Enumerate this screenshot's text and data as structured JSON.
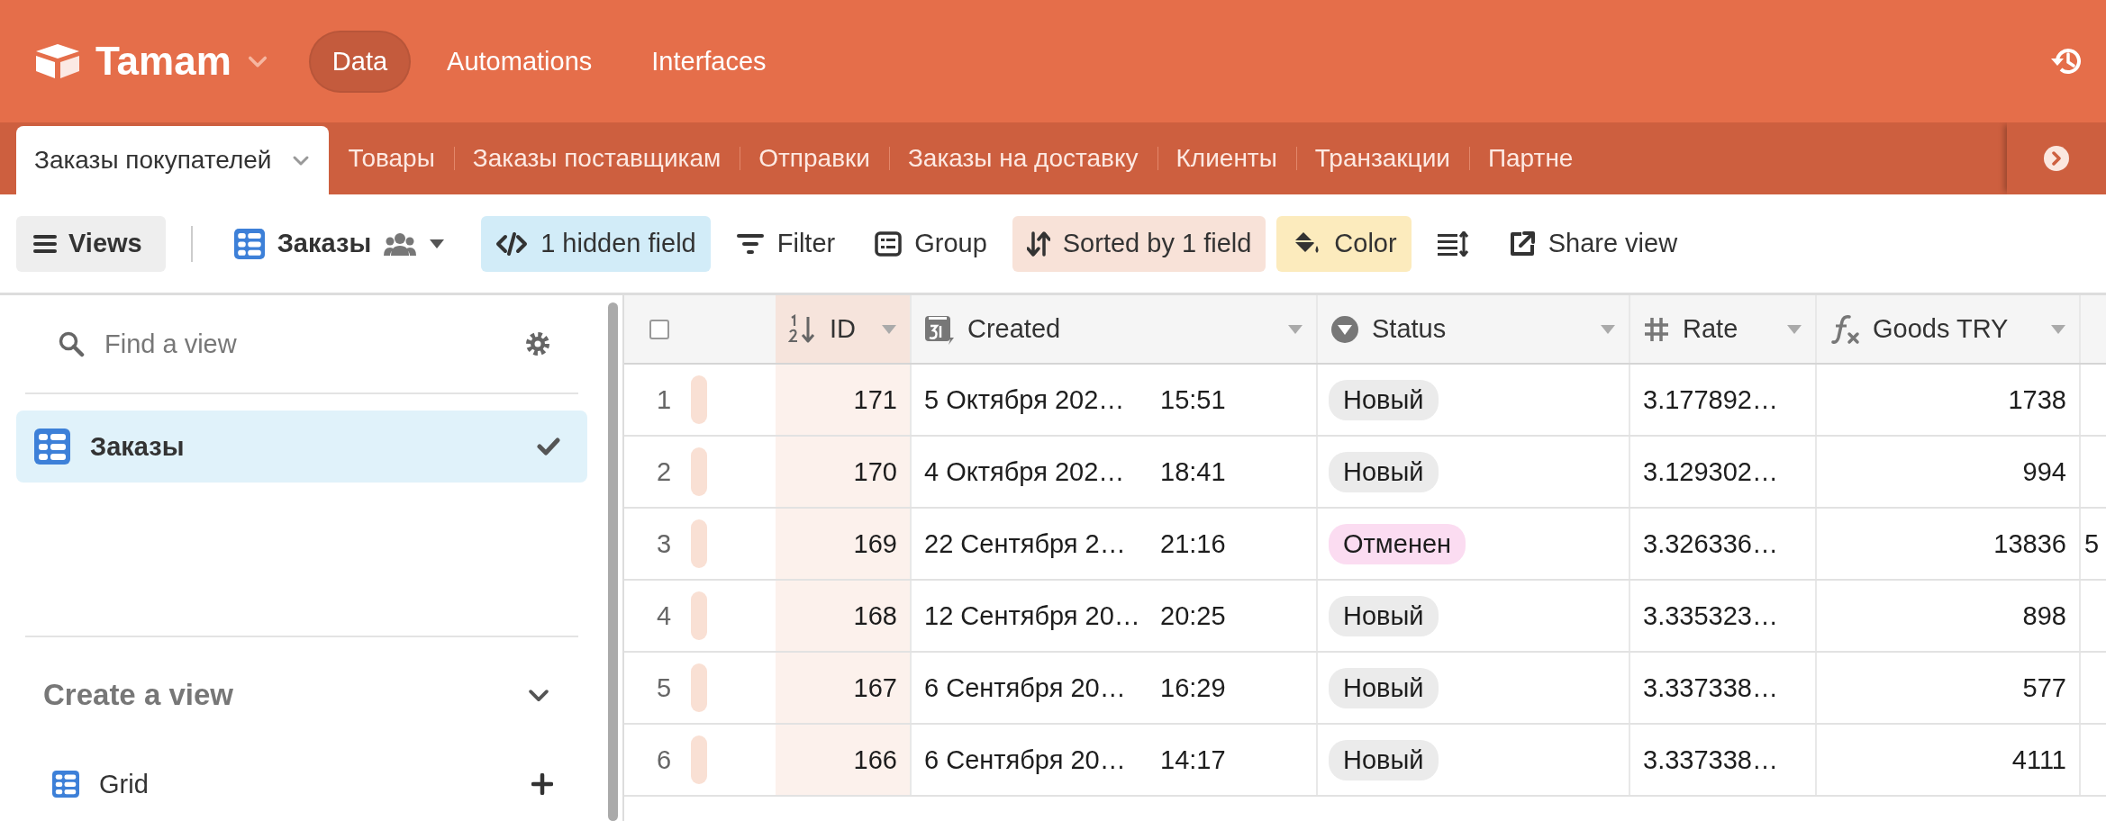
{
  "app": {
    "name": "Tamam",
    "nav": [
      {
        "label": "Data",
        "selected": true
      },
      {
        "label": "Automations",
        "selected": false
      },
      {
        "label": "Interfaces",
        "selected": false
      }
    ]
  },
  "tables": [
    {
      "label": "Заказы покупателей",
      "selected": true
    },
    {
      "label": "Товары",
      "selected": false
    },
    {
      "label": "Заказы поставщикам",
      "selected": false
    },
    {
      "label": "Отправки",
      "selected": false
    },
    {
      "label": "Заказы на доставку",
      "selected": false
    },
    {
      "label": "Клиенты",
      "selected": false
    },
    {
      "label": "Транзакции",
      "selected": false
    },
    {
      "label": "Партне",
      "selected": false
    }
  ],
  "toolbar": {
    "views_button": "Views",
    "view_name": "Заказы",
    "buttons": [
      {
        "kind": "hidden",
        "label": "1 hidden field",
        "active": true
      },
      {
        "kind": "filter",
        "label": "Filter",
        "active": false
      },
      {
        "kind": "group",
        "label": "Group",
        "active": false
      },
      {
        "kind": "sort",
        "label": "Sorted by 1 field",
        "active": true
      },
      {
        "kind": "color",
        "label": "Color",
        "active": true
      },
      {
        "kind": "rowheight",
        "active": false
      },
      {
        "kind": "share",
        "label": "Share view",
        "active": false
      }
    ]
  },
  "sidebar": {
    "search": {
      "placeholder": "Find a view"
    },
    "views": [
      {
        "label": "Заказы",
        "selected": true
      }
    ],
    "create": {
      "title": "Create a view",
      "expanded": true,
      "items": [
        {
          "label": "Grid"
        }
      ]
    }
  },
  "grid": {
    "select_all": {
      "checked": false
    },
    "columns": [
      {
        "kind": "number",
        "label": "ID",
        "sorted": true
      },
      {
        "kind": "date",
        "label": "Created",
        "sorted": false
      },
      {
        "kind": "select",
        "label": "Status",
        "sorted": false
      },
      {
        "kind": "decimal",
        "label": "Rate",
        "sorted": false
      },
      {
        "kind": "formula",
        "label": "Goods TRY",
        "sorted": false
      }
    ],
    "rows": [
      {
        "number": "1",
        "color": "#f9e0d4",
        "id": "171",
        "date": "5 Октября 202…",
        "time": "15:51",
        "status": {
          "label": "Новый",
          "color": "#ebebeb"
        },
        "rate": "3.177892…",
        "goods": "1738"
      },
      {
        "number": "2",
        "color": "#f9e0d4",
        "id": "170",
        "date": "4 Октября 202…",
        "time": "18:41",
        "status": {
          "label": "Новый",
          "color": "#ebebeb"
        },
        "rate": "3.129302…",
        "goods": "994"
      },
      {
        "number": "3",
        "color": "#f9e0d4",
        "id": "169",
        "date": "22 Сентября 2…",
        "time": "21:16",
        "status": {
          "label": "Отменен",
          "color": "#fbdcf1"
        },
        "rate": "3.326336…",
        "goods": "13836",
        "column_7": "5"
      },
      {
        "number": "4",
        "color": "#f9e0d4",
        "id": "168",
        "date": "12 Сентября 20…",
        "time": "20:25",
        "status": {
          "label": "Новый",
          "color": "#ebebeb"
        },
        "rate": "3.335323…",
        "goods": "898"
      },
      {
        "number": "5",
        "color": "#f9e0d4",
        "id": "167",
        "date": "6 Сентября 20…",
        "time": "16:29",
        "status": {
          "label": "Новый",
          "color": "#ebebeb"
        },
        "rate": "3.337338…",
        "goods": "577"
      },
      {
        "number": "6",
        "color": "#f9e0d4",
        "id": "166",
        "date": "6 Сентября 20…",
        "time": "14:17",
        "status": {
          "label": "Новый",
          "color": "#ebebeb"
        },
        "rate": "3.337338…",
        "goods": "4111"
      }
    ]
  }
}
